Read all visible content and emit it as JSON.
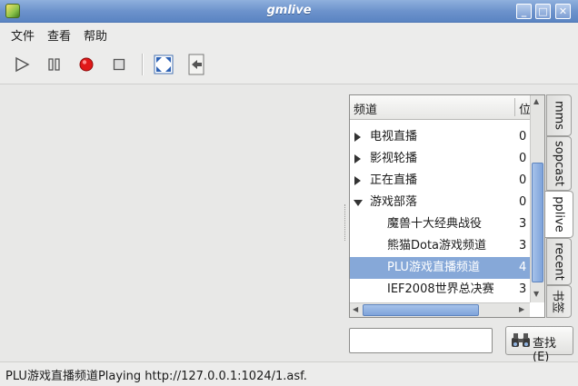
{
  "window": {
    "title": "gmlive"
  },
  "menu": {
    "items": [
      "文件",
      "查看",
      "帮助"
    ]
  },
  "toolbar": {
    "buttons": [
      "play-icon",
      "pause-icon",
      "record-icon",
      "stop-icon",
      "fullscreen-icon",
      "back-icon"
    ]
  },
  "tree": {
    "columns": {
      "name": "频道",
      "pos": "位"
    },
    "rows": [
      {
        "label": "电视直播",
        "num": "0",
        "expander": "closed"
      },
      {
        "label": "影视轮播",
        "num": "0",
        "expander": "closed"
      },
      {
        "label": "正在直播",
        "num": "0",
        "expander": "closed"
      },
      {
        "label": "游戏部落",
        "num": "0",
        "expander": "open"
      },
      {
        "label": "魔兽十大经典战役",
        "num": "3",
        "expander": "none"
      },
      {
        "label": "熊猫Dota游戏频道",
        "num": "3",
        "expander": "none"
      },
      {
        "label": "PLU游戏直播频道",
        "num": "4",
        "expander": "none",
        "selected": true
      },
      {
        "label": "IEF2008世界总决赛",
        "num": "3",
        "expander": "none"
      }
    ]
  },
  "tabs": [
    "mms",
    "sopcast",
    "pplive",
    "recent",
    "书签"
  ],
  "active_tab": "pplive",
  "search": {
    "value": "",
    "button_label": "查找(E)"
  },
  "status": {
    "text": "PLU游戏直播频道Playing http://127.0.0.1:1024/1.asf."
  },
  "colors": {
    "selection": "#86a8d8",
    "titlebar": "#6d93cc"
  }
}
